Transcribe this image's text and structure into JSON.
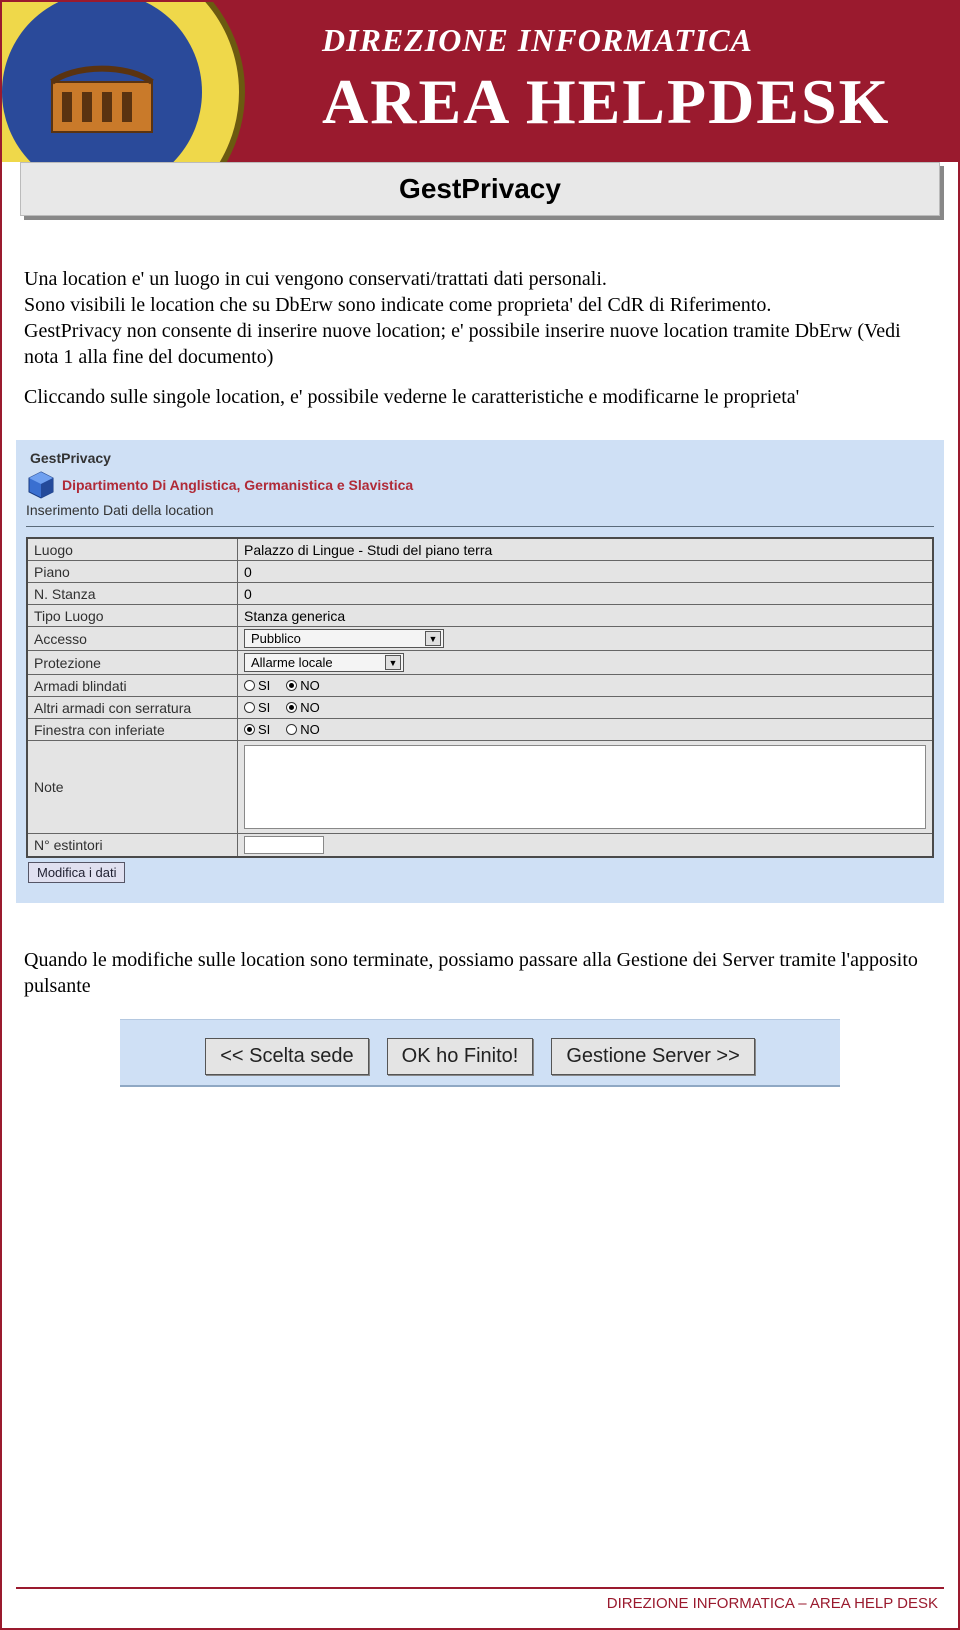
{
  "header": {
    "subtitle": "DIREZIONE INFORMATICA",
    "title": "AREA HELPDESK"
  },
  "page_title": "GestPrivacy",
  "intro": {
    "p1a": "Una location e' un luogo in cui vengono conservati/trattati dati personali.",
    "p1b": "Sono visibili le location che su DbErw sono indicate come proprieta' del CdR di Riferimento.",
    "p1c": "GestPrivacy non consente di inserire nuove location; e' possibile inserire nuove location tramite DbErw (Vedi nota 1 alla fine del documento)",
    "p2": "Cliccando sulle singole location, e' possibile vederne le caratteristiche e modificarne le proprieta'"
  },
  "form": {
    "legend": "GestPrivacy",
    "department": "Dipartimento Di Anglistica, Germanistica e Slavistica",
    "subtitle": "Inserimento Dati della location",
    "rows": {
      "luogo_l": "Luogo",
      "luogo_v": "Palazzo di Lingue - Studi del piano terra",
      "piano_l": "Piano",
      "piano_v": "0",
      "nstanza_l": "N. Stanza",
      "nstanza_v": "0",
      "tipoluogo_l": "Tipo Luogo",
      "tipoluogo_v": "Stanza generica",
      "accesso_l": "Accesso",
      "accesso_v": "Pubblico",
      "protezione_l": "Protezione",
      "protezione_v": "Allarme locale",
      "armadibl_l": "Armadi blindati",
      "altriarm_l": "Altri armadi con serratura",
      "finestra_l": "Finestra con inferiate",
      "note_l": "Note",
      "nestint_l": "N° estintori",
      "si": "SI",
      "no": "NO"
    },
    "modify_btn": "Modifica i dati"
  },
  "after_form": "Quando le modifiche sulle location sono terminate, possiamo passare alla Gestione dei Server tramite l'apposito pulsante",
  "nav": {
    "back": "<<  Scelta sede",
    "ok": "OK ho Finito!",
    "next": "Gestione Server >>"
  },
  "footer": "DIREZIONE INFORMATICA – AREA HELP DESK"
}
